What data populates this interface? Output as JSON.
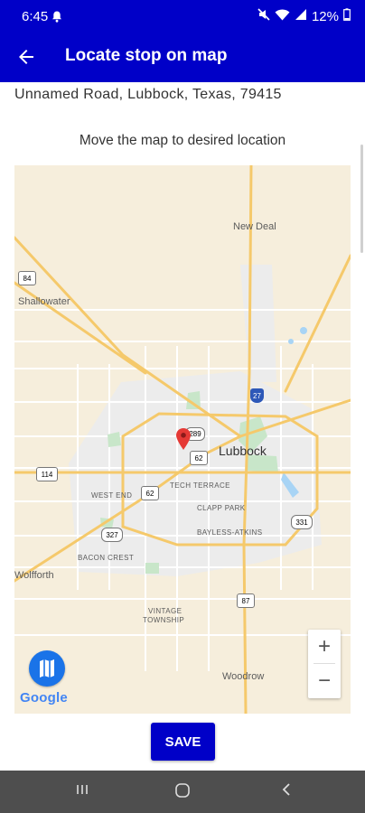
{
  "status_bar": {
    "time": "6:45",
    "battery": "12%"
  },
  "app_bar": {
    "title": "Locate stop on map"
  },
  "address": "Unnamed Road, Lubbock, Texas, 79415",
  "hint": "Move the map to desired location",
  "map": {
    "labels": {
      "new_deal": "New Deal",
      "shallowater": "Shallowater",
      "lubbock": "Lubbock",
      "tech_terrace": "TECH TERRACE",
      "west_end": "WEST END",
      "clapp_park": "CLAPP PARK",
      "bayless_atkins": "BAYLESS-ATKINS",
      "bacon_crest": "BACON CREST",
      "vintage": "VINTAGE",
      "township": "TOWNSHIP",
      "wolfforth": "Wolfforth",
      "woodrow": "Woodrow"
    },
    "shields": {
      "s84": "84",
      "s27": "27",
      "s289a": "289",
      "s62": "62",
      "s114": "114",
      "s62b": "62",
      "s327": "327",
      "s331": "331",
      "s87": "87"
    },
    "zoom_in": "+",
    "zoom_out": "−",
    "attribution": "Google"
  },
  "save_label": "SAVE"
}
